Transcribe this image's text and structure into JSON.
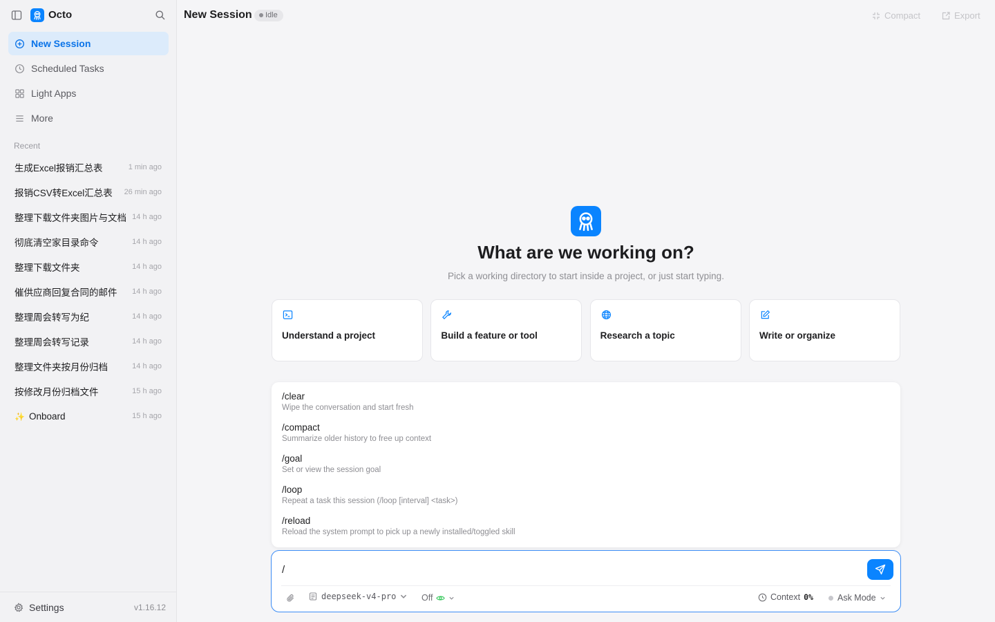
{
  "app": {
    "name": "Octo",
    "version": "v1.16.12"
  },
  "nav": [
    {
      "label": "New Session",
      "icon": "plus-circle-icon",
      "active": true
    },
    {
      "label": "Scheduled Tasks",
      "icon": "clock-icon"
    },
    {
      "label": "Light Apps",
      "icon": "grid-icon"
    },
    {
      "label": "More",
      "icon": "menu-icon"
    }
  ],
  "recent": {
    "title": "Recent",
    "items": [
      {
        "title": "生成Excel报销汇总表",
        "time": "1 min ago"
      },
      {
        "title": "报销CSV转Excel汇总表",
        "time": "26 min ago"
      },
      {
        "title": "整理下载文件夹图片与文档",
        "time": "14 h ago"
      },
      {
        "title": "彻底清空家目录命令",
        "time": "14 h ago"
      },
      {
        "title": "整理下载文件夹",
        "time": "14 h ago"
      },
      {
        "title": "催供应商回复合同的邮件",
        "time": "14 h ago"
      },
      {
        "title": "整理周会转写为纪",
        "time": "14 h ago"
      },
      {
        "title": "整理周会转写记录",
        "time": "14 h ago"
      },
      {
        "title": "整理文件夹按月份归档",
        "time": "14 h ago"
      },
      {
        "title": "按修改月份归档文件",
        "time": "15 h ago"
      },
      {
        "title": "Onboard",
        "time": "15 h ago",
        "sparkle": "✨"
      }
    ]
  },
  "footer": {
    "settings_label": "Settings"
  },
  "header": {
    "title": "New Session",
    "status": "Idle",
    "compact_label": "Compact",
    "export_label": "Export"
  },
  "hero": {
    "title": "What are we working on?",
    "subtitle": "Pick a working directory to start inside a project, or just start typing."
  },
  "cards": [
    {
      "label": "Understand a project",
      "icon": "terminal-icon"
    },
    {
      "label": "Build a feature or tool",
      "icon": "wrench-icon"
    },
    {
      "label": "Research a topic",
      "icon": "globe-icon"
    },
    {
      "label": "Write or organize",
      "icon": "edit-icon"
    }
  ],
  "commands": [
    {
      "name": "/clear",
      "desc": "Wipe the conversation and start fresh"
    },
    {
      "name": "/compact",
      "desc": "Summarize older history to free up context"
    },
    {
      "name": "/goal",
      "desc": "Set or view the session goal"
    },
    {
      "name": "/loop",
      "desc": "Repeat a task this session (/loop [interval] <task>)"
    },
    {
      "name": "/reload",
      "desc": "Reload the system prompt to pick up a newly installed/toggled skill"
    }
  ],
  "composer": {
    "value": "/",
    "model": "deepseek-v4-pro",
    "thinking": "Off",
    "context_label": "Context",
    "context_value": "0%",
    "mode": "Ask Mode"
  },
  "colors": {
    "accent": "#0a84ff",
    "active_bg": "#dcebfb",
    "status_green": "#34c759"
  }
}
